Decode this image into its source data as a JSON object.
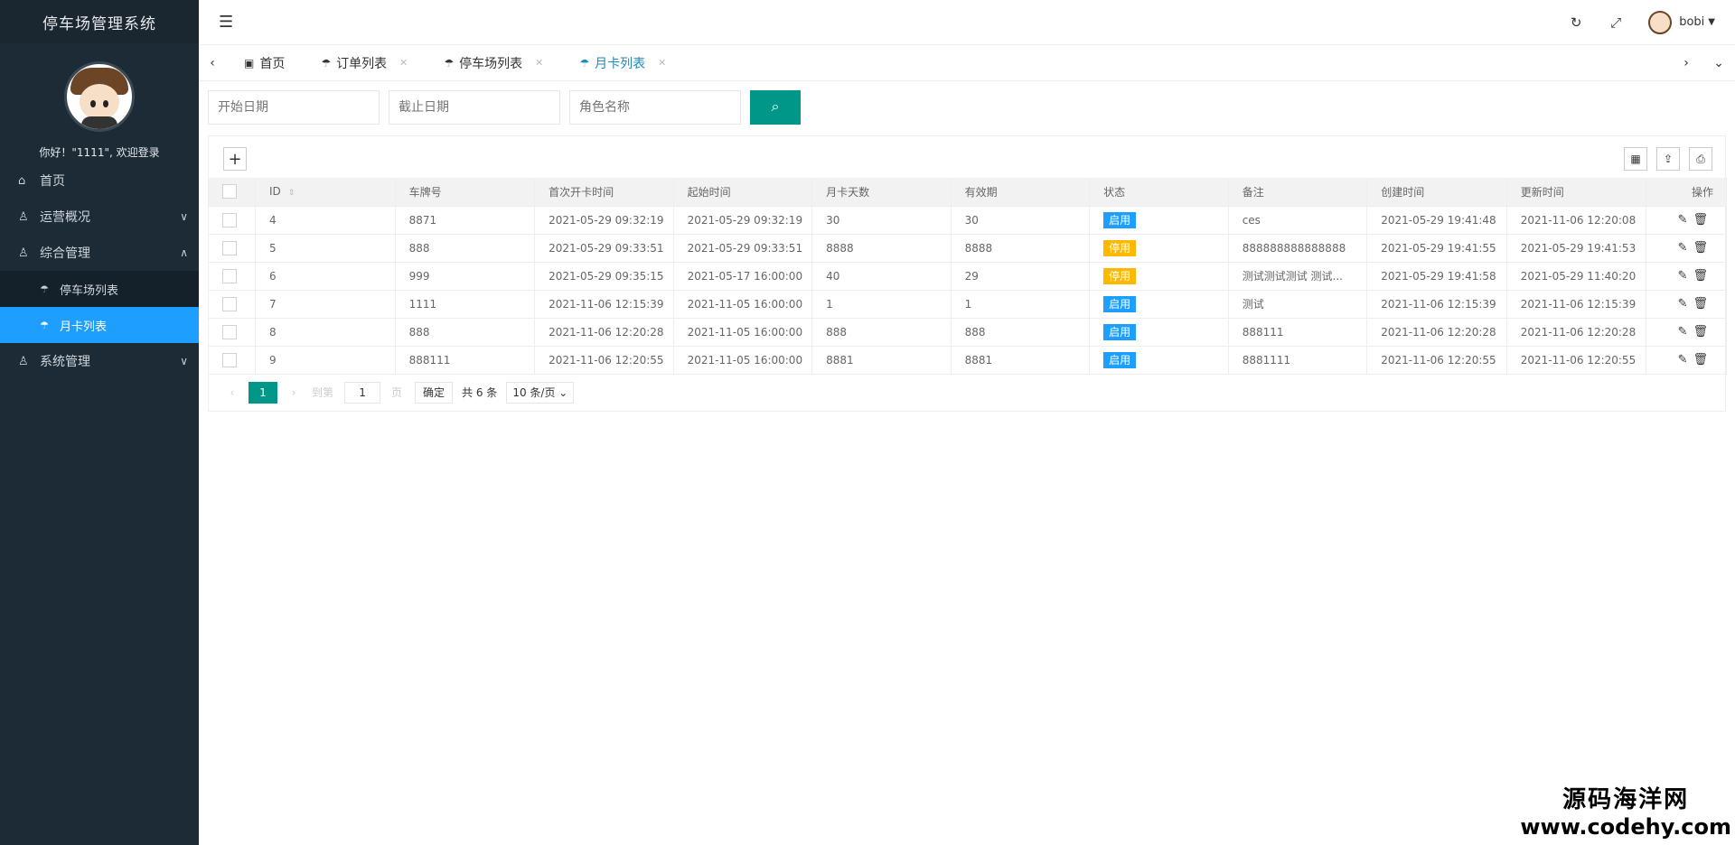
{
  "app": {
    "title": "停车场管理系统"
  },
  "profile": {
    "welcome": "你好！\"1111\", 欢迎登录"
  },
  "menu": [
    {
      "label": "首页",
      "icon": "home-icon"
    },
    {
      "label": "运营概况",
      "icon": "user-icon",
      "chevron": "∨"
    },
    {
      "label": "综合管理",
      "icon": "user-icon",
      "chevron": "∧"
    },
    {
      "label": "停车场列表",
      "icon": "umbrella-icon",
      "sub": true
    },
    {
      "label": "月卡列表",
      "icon": "umbrella-icon",
      "sub": true,
      "active": true
    },
    {
      "label": "系统管理",
      "icon": "user-icon",
      "chevron": "∨"
    }
  ],
  "header": {
    "user": "bobi"
  },
  "tabs": [
    {
      "label": "首页"
    },
    {
      "label": "订单列表"
    },
    {
      "label": "停车场列表"
    },
    {
      "label": "月卡列表",
      "active": true
    }
  ],
  "search": {
    "start_placeholder": "开始日期",
    "end_placeholder": "截止日期",
    "role_placeholder": "角色名称"
  },
  "table": {
    "columns": [
      "ID",
      "车牌号",
      "首次开卡时间",
      "起始时间",
      "月卡天数",
      "有效期",
      "状态",
      "备注",
      "创建时间",
      "更新时间",
      "操作"
    ],
    "rows": [
      {
        "id": "4",
        "plate": "8871",
        "first_open": "2021-05-29 09:32:19",
        "start": "2021-05-29 09:32:19",
        "days": "30",
        "valid": "30",
        "status": "启用",
        "status_on": true,
        "remark": "ces",
        "created": "2021-05-29 19:41:48",
        "updated": "2021-11-06 12:20:08"
      },
      {
        "id": "5",
        "plate": "888",
        "first_open": "2021-05-29 09:33:51",
        "start": "2021-05-29 09:33:51",
        "days": "8888",
        "valid": "8888",
        "status": "停用",
        "status_on": false,
        "remark": "888888888888888",
        "created": "2021-05-29 19:41:55",
        "updated": "2021-05-29 19:41:53"
      },
      {
        "id": "6",
        "plate": "999",
        "first_open": "2021-05-29 09:35:15",
        "start": "2021-05-17 16:00:00",
        "days": "40",
        "valid": "29",
        "status": "停用",
        "status_on": false,
        "remark": "测试测试测试 测试...",
        "created": "2021-05-29 19:41:58",
        "updated": "2021-05-29 11:40:20"
      },
      {
        "id": "7",
        "plate": "1111",
        "first_open": "2021-11-06 12:15:39",
        "start": "2021-11-05 16:00:00",
        "days": "1",
        "valid": "1",
        "status": "启用",
        "status_on": true,
        "remark": "测试",
        "created": "2021-11-06 12:15:39",
        "updated": "2021-11-06 12:15:39"
      },
      {
        "id": "8",
        "plate": "888",
        "first_open": "2021-11-06 12:20:28",
        "start": "2021-11-05 16:00:00",
        "days": "888",
        "valid": "888",
        "status": "启用",
        "status_on": true,
        "remark": "888111",
        "created": "2021-11-06 12:20:28",
        "updated": "2021-11-06 12:20:28"
      },
      {
        "id": "9",
        "plate": "888111",
        "first_open": "2021-11-06 12:20:55",
        "start": "2021-11-05 16:00:00",
        "days": "8881",
        "valid": "8881",
        "status": "启用",
        "status_on": true,
        "remark": "8881111",
        "created": "2021-11-06 12:20:55",
        "updated": "2021-11-06 12:20:55"
      }
    ]
  },
  "pager": {
    "current": "1",
    "goto_label": "到第",
    "goto_value": "1",
    "page_unit": "页",
    "confirm": "确定",
    "total": "共 6 条",
    "per_page": "10 条/页"
  },
  "watermark": {
    "line1": "源码海洋网",
    "line2": "www.codehy.com"
  },
  "colors": {
    "sidebar_bg": "#1c2b36",
    "active_menu": "#1e9fff",
    "primary": "#009688",
    "badge_on": "#1e9fff",
    "badge_off": "#ffb800"
  }
}
